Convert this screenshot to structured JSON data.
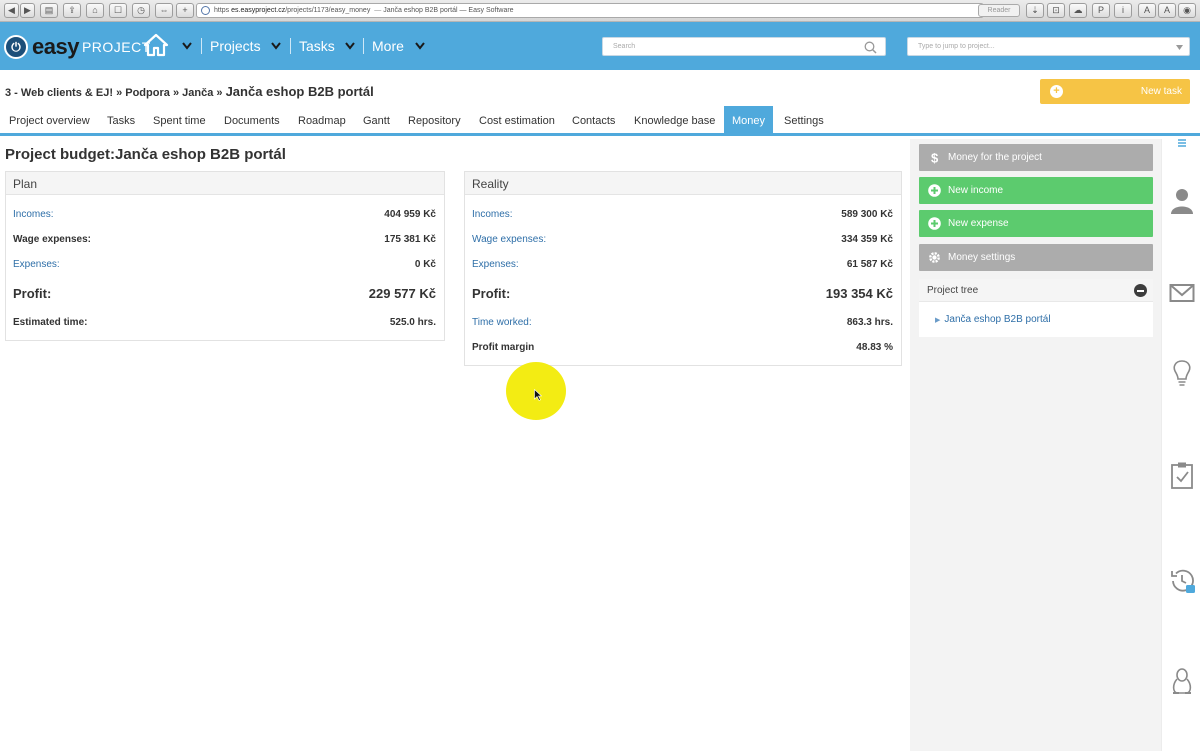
{
  "browser": {
    "url_scheme": "https",
    "url_host": "es.easyproject.cz",
    "url_path": "/projects/1173/easy_money",
    "page_title": "Janča eshop B2B portál — Easy Software",
    "reader_label": "Reader"
  },
  "header": {
    "logo_easy": "easy",
    "logo_project": "PROJECT",
    "nav": {
      "projects": "Projects",
      "tasks": "Tasks",
      "more": "More"
    },
    "search_placeholder": "Search",
    "jump_placeholder": "Type to jump to project..."
  },
  "breadcrumb": {
    "items": [
      "3 - Web clients & EJ!",
      "Podpora",
      "Janča"
    ],
    "separator": "»",
    "current": "Janča eshop B2B portál"
  },
  "new_task_label": "New task",
  "tabs": [
    {
      "label": "Project overview"
    },
    {
      "label": "Tasks"
    },
    {
      "label": "Spent time"
    },
    {
      "label": "Documents"
    },
    {
      "label": "Roadmap"
    },
    {
      "label": "Gantt"
    },
    {
      "label": "Repository"
    },
    {
      "label": "Cost estimation"
    },
    {
      "label": "Contacts"
    },
    {
      "label": "Knowledge base"
    },
    {
      "label": "Money",
      "active": true
    },
    {
      "label": "Settings"
    }
  ],
  "page_title": "Project budget:Janča eshop B2B portál",
  "plan": {
    "title": "Plan",
    "incomes_label": "Incomes:",
    "incomes_value": "404 959 Kč",
    "wage_label": "Wage expenses:",
    "wage_value": "175 381 Kč",
    "expenses_label": "Expenses:",
    "expenses_value": "0 Kč",
    "profit_label": "Profit:",
    "profit_value": "229 577 Kč",
    "time_label": "Estimated time:",
    "time_value": "525.0 hrs."
  },
  "reality": {
    "title": "Reality",
    "incomes_label": "Incomes:",
    "incomes_value": "589 300 Kč",
    "wage_label": "Wage expenses:",
    "wage_value": "334 359 Kč",
    "expenses_label": "Expenses:",
    "expenses_value": "61 587 Kč",
    "profit_label": "Profit:",
    "profit_value": "193 354 Kč",
    "time_label": "Time worked:",
    "time_value": "863.3 hrs.",
    "margin_label": "Profit margin",
    "margin_value": "48.83 %"
  },
  "sidebar": {
    "money_for_project": "Money for the project",
    "new_income": "New income",
    "new_expense": "New expense",
    "money_settings": "Money settings",
    "project_tree_title": "Project tree",
    "tree_item": "Janča eshop B2B portál"
  },
  "colors": {
    "header_blue": "#4fa9dc",
    "link_blue": "#2f6fa8",
    "green": "#5ccb6e",
    "grey": "#acacac",
    "yellow": "#f6c445"
  }
}
